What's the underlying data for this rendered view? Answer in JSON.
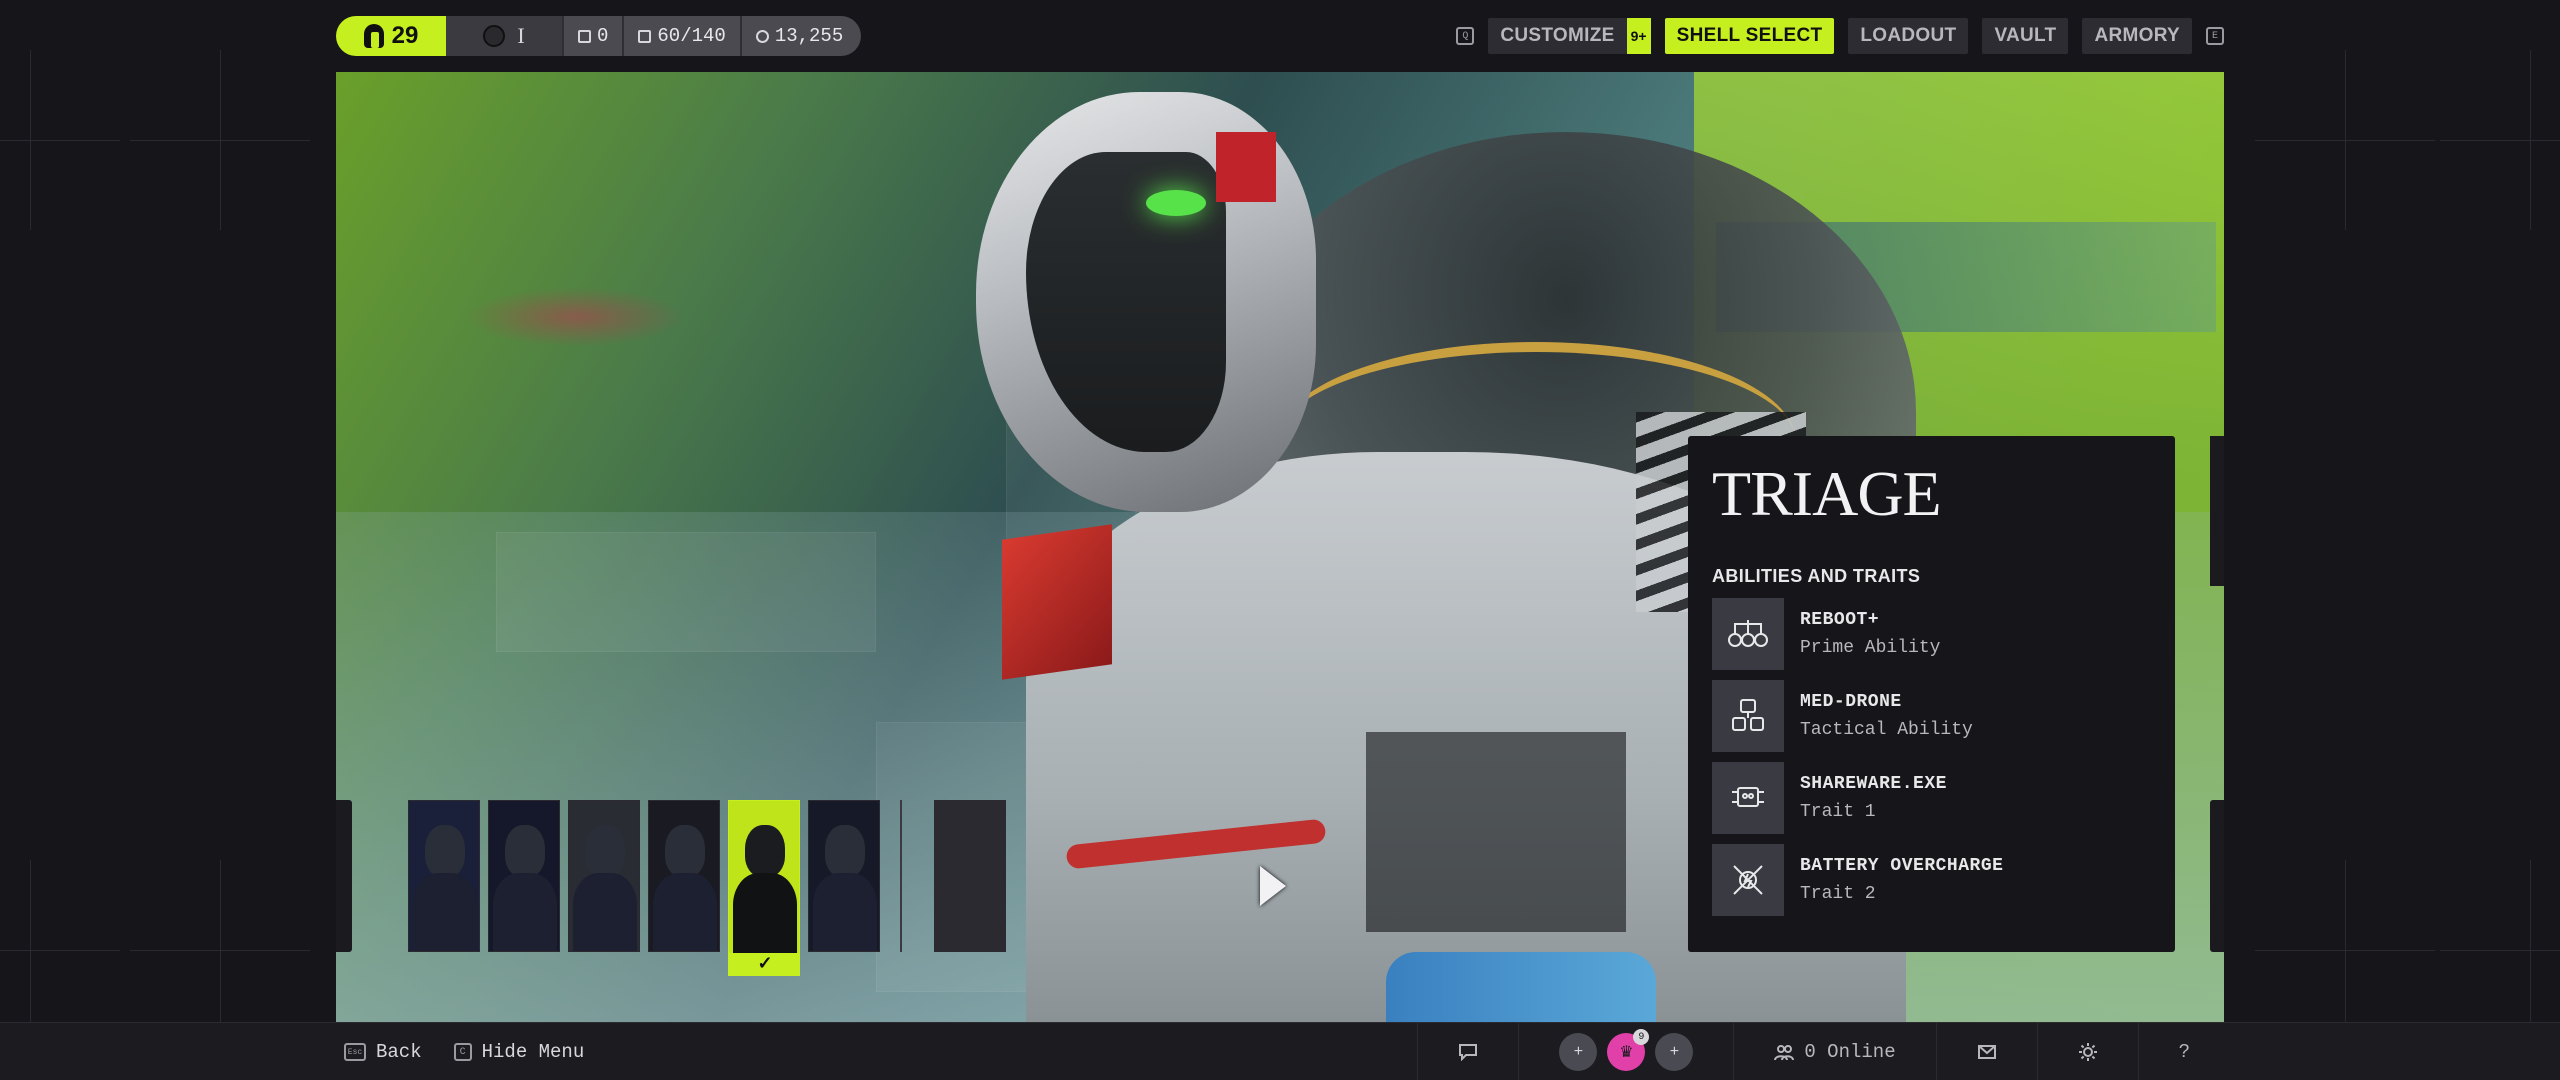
{
  "topbar": {
    "level": "29",
    "rank": "I",
    "stats": [
      "0",
      "60/140",
      "13,255"
    ],
    "nav": {
      "key_left": "Q",
      "customize": "CUSTOMIZE",
      "customize_badge": "9+",
      "shell_select": "SHELL SELECT",
      "loadout": "LOADOUT",
      "vault": "VAULT",
      "armory": "ARMORY",
      "key_right": "E"
    }
  },
  "shell": {
    "name": "TRIAGE",
    "section_title": "ABILITIES AND TRAITS",
    "abilities": [
      {
        "name": "REBOOT+",
        "type": "Prime Ability",
        "icon": "reboot-icon"
      },
      {
        "name": "MED-DRONE",
        "type": "Tactical Ability",
        "icon": "drone-icon"
      },
      {
        "name": "SHAREWARE.EXE",
        "type": "Trait 1",
        "icon": "shareware-icon"
      },
      {
        "name": "BATTERY OVERCHARGE",
        "type": "Trait 2",
        "icon": "battery-icon"
      }
    ]
  },
  "carousel": {
    "thumbs": [
      "shell-1",
      "shell-2",
      "shell-3",
      "shell-4",
      "shell-5",
      "shell-6"
    ],
    "selected_index": 4,
    "thumb_colors": [
      "#1a1f3a",
      "#14182a",
      "#2a2c34",
      "#1a1a22",
      "#bfe41a",
      "#161a28"
    ]
  },
  "bottombar": {
    "back_key": "Esc",
    "back": "Back",
    "hide_key": "C",
    "hide": "Hide Menu",
    "online": "0 Online",
    "avatar_badge": "9"
  },
  "colors": {
    "accent": "#c6ef1f",
    "panel": "#16161a",
    "avatar": "#e040a8"
  }
}
